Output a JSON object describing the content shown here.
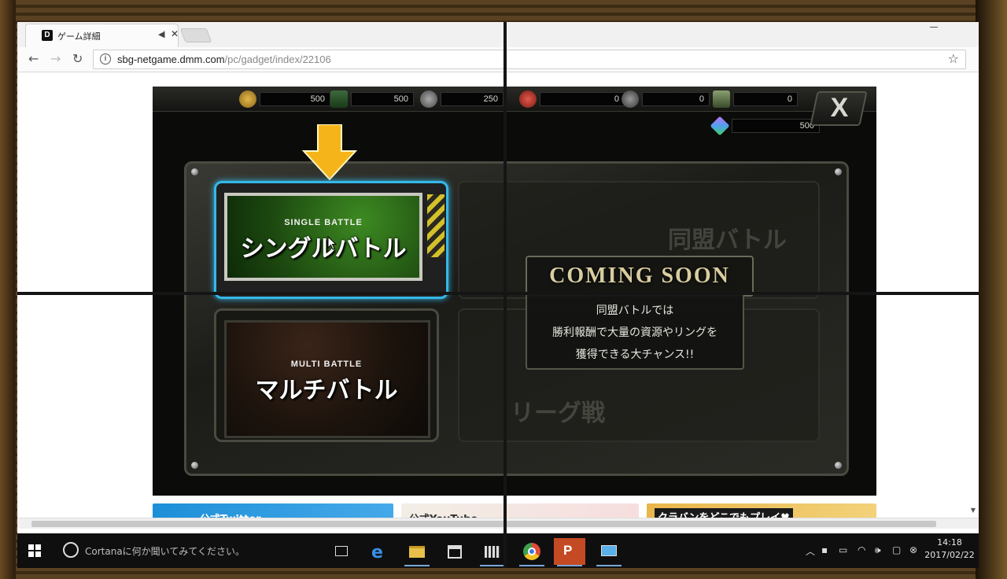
{
  "browser": {
    "tab_title": "ゲーム詳細",
    "tab_logo": "D",
    "url_host": "sbg-netgame.dmm.com",
    "url_path": "/pc/gadget/index/22106",
    "icons": {
      "back": "back-arrow-icon",
      "forward": "forward-arrow-icon",
      "reload": "reload-icon",
      "bookmark": "star-icon"
    }
  },
  "game": {
    "resources": [
      {
        "name": "gold",
        "value": "500"
      },
      {
        "name": "supply",
        "value": "500"
      },
      {
        "name": "parts",
        "value": "250"
      },
      {
        "name": "bag",
        "value": "0"
      },
      {
        "name": "gear",
        "value": "0"
      },
      {
        "name": "cash",
        "value": "0"
      }
    ],
    "crystal_value": "500",
    "close_label": "X",
    "single_battle": {
      "sub": "SINGLE BATTLE",
      "main": "シングルバトル"
    },
    "multi_battle": {
      "sub": "MULTI BATTLE",
      "main": "マルチバトル"
    },
    "ghost_labels": {
      "alliance": "同盟バトル",
      "league": "リーグ戦"
    },
    "coming_soon": "COMING SOON",
    "description": [
      "同盟バトルでは",
      "勝利報酬で大量の資源やリングを",
      "獲得できる大チャンス!!"
    ]
  },
  "banners": {
    "twitter": "公式Twitter",
    "youtube": "公式YouTube",
    "play": "クラバンをどこでもプレイ♥"
  },
  "taskbar": {
    "cortana_placeholder": "Cortanaに何か聞いてみてください。",
    "time": "14:18",
    "date": "2017/02/22"
  },
  "colors": {
    "selection_glow": "#35b8e8",
    "arrow": "#f5b51a",
    "coming_soon_text": "#d9cda0",
    "twitter_blue": "#1d8fd8"
  }
}
